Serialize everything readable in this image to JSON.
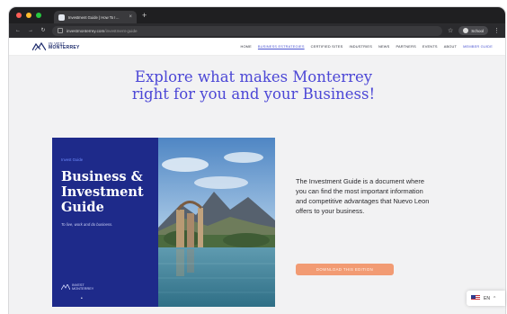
{
  "browser": {
    "tab_title": "Investment Guide | How To I…",
    "tab_close": "×",
    "new_tab": "+",
    "url_host": "investmonterrey.com",
    "url_path": "/investment-guide",
    "profile_name": "School",
    "traffic_colors": [
      "#ff5f57",
      "#febc2e",
      "#28c840"
    ]
  },
  "site": {
    "logo_line1": "IN VEST",
    "logo_line2": "MONTERREY",
    "nav": [
      {
        "label": "HOME"
      },
      {
        "label": "BUSINESS ESTRATEGIES"
      },
      {
        "label": "CERTIFIED SITES"
      },
      {
        "label": "INDUSTRIES"
      },
      {
        "label": "NEWS"
      },
      {
        "label": "PARTNERS"
      },
      {
        "label": "EVENTS"
      },
      {
        "label": "ABOUT"
      },
      {
        "label": "MEMBER GUIDE"
      }
    ],
    "accent_color": "#4c47d6"
  },
  "hero": {
    "line1": "Explore what makes Monterrey",
    "line2": "right for you and your Business!"
  },
  "guide": {
    "eyebrow": "Invest Guide",
    "title_line1": "Business &",
    "title_line2": "Investment",
    "title_line3": "Guide",
    "subtitle": "To live, work and do business.",
    "brand_line1": "INVEST",
    "brand_line2": "MONTERREY",
    "panel_color": "#1e2a8a"
  },
  "description": "The Investment Guide is a document where you can find the most important information and competitive advantages that Nuevo Leon offers to your business.",
  "cta_label": "DOWNLOAD THIS EDITION",
  "language": {
    "code": "EN",
    "chevron": "^"
  }
}
